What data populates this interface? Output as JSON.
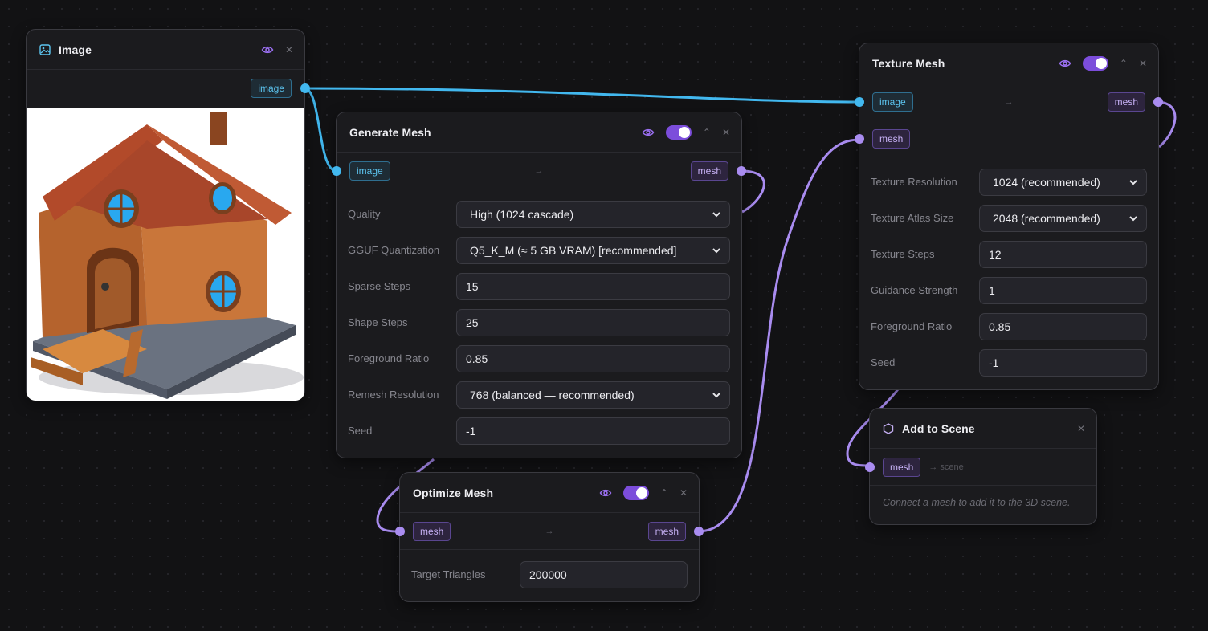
{
  "colors": {
    "background": "#121214",
    "node": "#1b1b1e",
    "image_wire": "#42b8ef",
    "mesh_wire": "#a98cf0",
    "toggle_on": "#7c4ddb"
  },
  "icons": {
    "image_node": "image-icon",
    "scene_node": "hexagon-icon",
    "visibility": "eye-icon",
    "collapse": "chevron-up-icon",
    "close": "close-icon",
    "dropdown": "chevron-down-icon",
    "flow": "arrow-right-icon"
  },
  "image_node": {
    "title": "Image",
    "output_label": "image"
  },
  "generate_mesh": {
    "title": "Generate Mesh",
    "enabled": true,
    "input_label": "image",
    "output_label": "mesh",
    "params": [
      {
        "label": "Quality",
        "value": "High (1024 cascade)",
        "kind": "select"
      },
      {
        "label": "GGUF Quantization",
        "value": "Q5_K_M (≈ 5 GB VRAM) [recommended]",
        "kind": "select"
      },
      {
        "label": "Sparse Steps",
        "value": "15",
        "kind": "input"
      },
      {
        "label": "Shape Steps",
        "value": "25",
        "kind": "input"
      },
      {
        "label": "Foreground Ratio",
        "value": "0.85",
        "kind": "input"
      },
      {
        "label": "Remesh Resolution",
        "value": "768 (balanced — recommended)",
        "kind": "select"
      },
      {
        "label": "Seed",
        "value": "-1",
        "kind": "input"
      }
    ]
  },
  "optimize_mesh": {
    "title": "Optimize Mesh",
    "enabled": true,
    "input_label": "mesh",
    "output_label": "mesh",
    "params": [
      {
        "label": "Target Triangles",
        "value": "200000",
        "kind": "input"
      }
    ]
  },
  "texture_mesh": {
    "title": "Texture Mesh",
    "enabled": true,
    "input_image_label": "image",
    "input_mesh_label": "mesh",
    "output_label": "mesh",
    "params": [
      {
        "label": "Texture Resolution",
        "value": "1024 (recommended)",
        "kind": "select"
      },
      {
        "label": "Texture Atlas Size",
        "value": "2048 (recommended)",
        "kind": "select"
      },
      {
        "label": "Texture Steps",
        "value": "12",
        "kind": "input"
      },
      {
        "label": "Guidance Strength",
        "value": "1",
        "kind": "input"
      },
      {
        "label": "Foreground Ratio",
        "value": "0.85",
        "kind": "input"
      },
      {
        "label": "Seed",
        "value": "-1",
        "kind": "input"
      }
    ]
  },
  "add_to_scene": {
    "title": "Add to Scene",
    "input_label": "mesh",
    "target_label": "→ scene",
    "hint": "Connect a mesh to add it to the 3D scene."
  }
}
